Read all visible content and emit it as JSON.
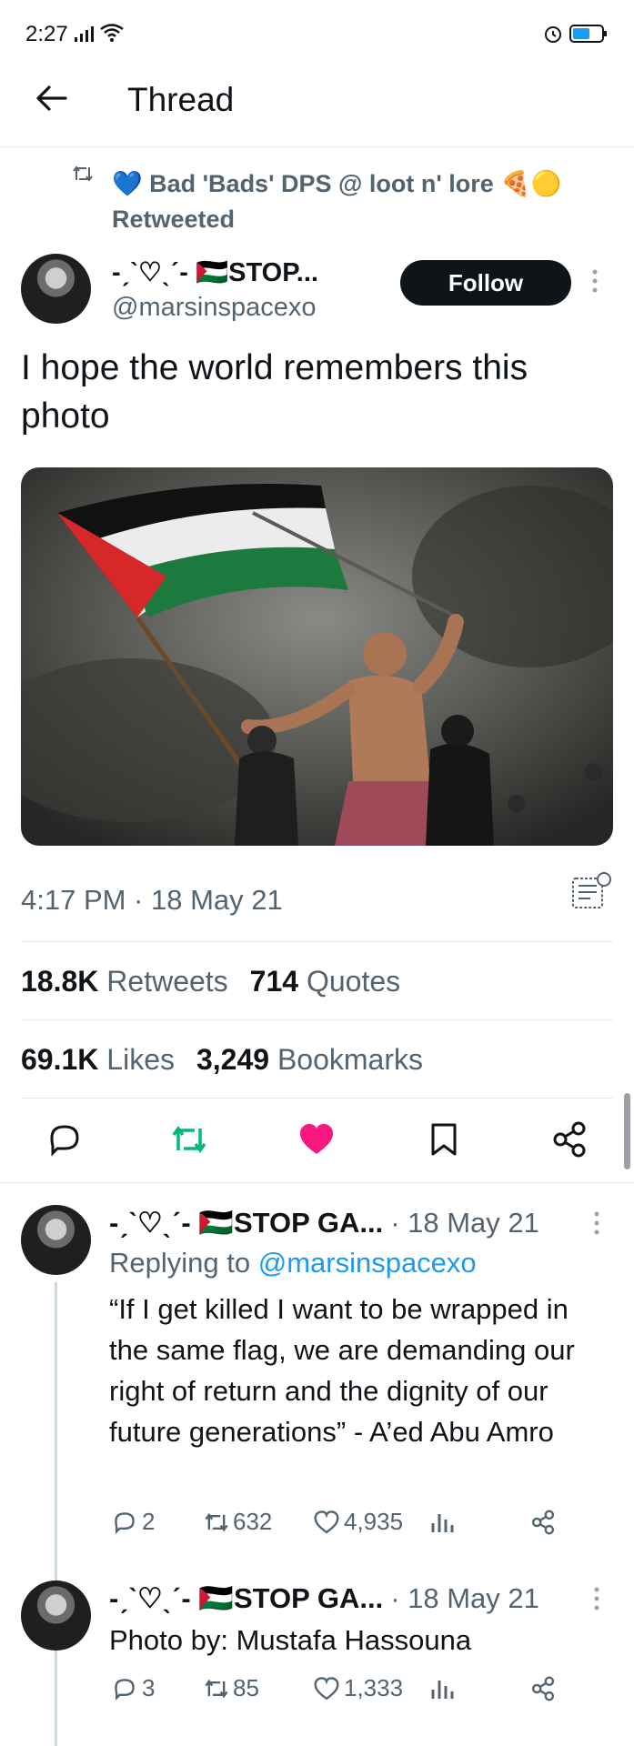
{
  "status_bar": {
    "time": "2:27",
    "signal": "signal-icon",
    "wifi": "wifi-icon",
    "alarm": "alarm-icon",
    "battery": "battery-icon"
  },
  "header": {
    "title": "Thread",
    "back_icon": "arrow-left-icon"
  },
  "retweet_banner": {
    "text": "💙 Bad 'Bads' DPS @ loot n' lore 🍕🟡",
    "subtext": "Retweeted"
  },
  "tweet": {
    "display_name": "-ˏˋ♡ˎˊ- 🇵🇸STOP...",
    "handle": "@marsinspacexo",
    "follow_label": "Follow",
    "text": "I hope the world remembers this photo",
    "timestamp": "4:17 PM · 18 May 21",
    "stats": {
      "retweets_num": "18.8K",
      "retweets_label": "Retweets",
      "quotes_num": "714",
      "quotes_label": "Quotes",
      "likes_num": "69.1K",
      "likes_label": "Likes",
      "bookmarks_num": "3,249",
      "bookmarks_label": "Bookmarks"
    },
    "colors": {
      "retweet": "#00ba7c",
      "like": "#f91880"
    }
  },
  "replies": [
    {
      "display_name": "-ˏˋ♡ˎˊ- 🇵🇸STOP GA...",
      "date": "· 18 May 21",
      "replying_prefix": "Replying to",
      "replying_handle": "@marsinspacexo",
      "text": "“If I get killed I want to be wrapped in the same flag, we are demanding our right of return and the dignity of our future generations” - A’ed Abu Amro",
      "comments": "2",
      "retweets": "632",
      "likes": "4,935"
    },
    {
      "display_name": "-ˏˋ♡ˎˊ- 🇵🇸STOP GA...",
      "date": "· 18 May 21",
      "text": "Photo by: Mustafa Hassouna",
      "comments": "3",
      "retweets": "85",
      "likes": "1,333"
    }
  ]
}
